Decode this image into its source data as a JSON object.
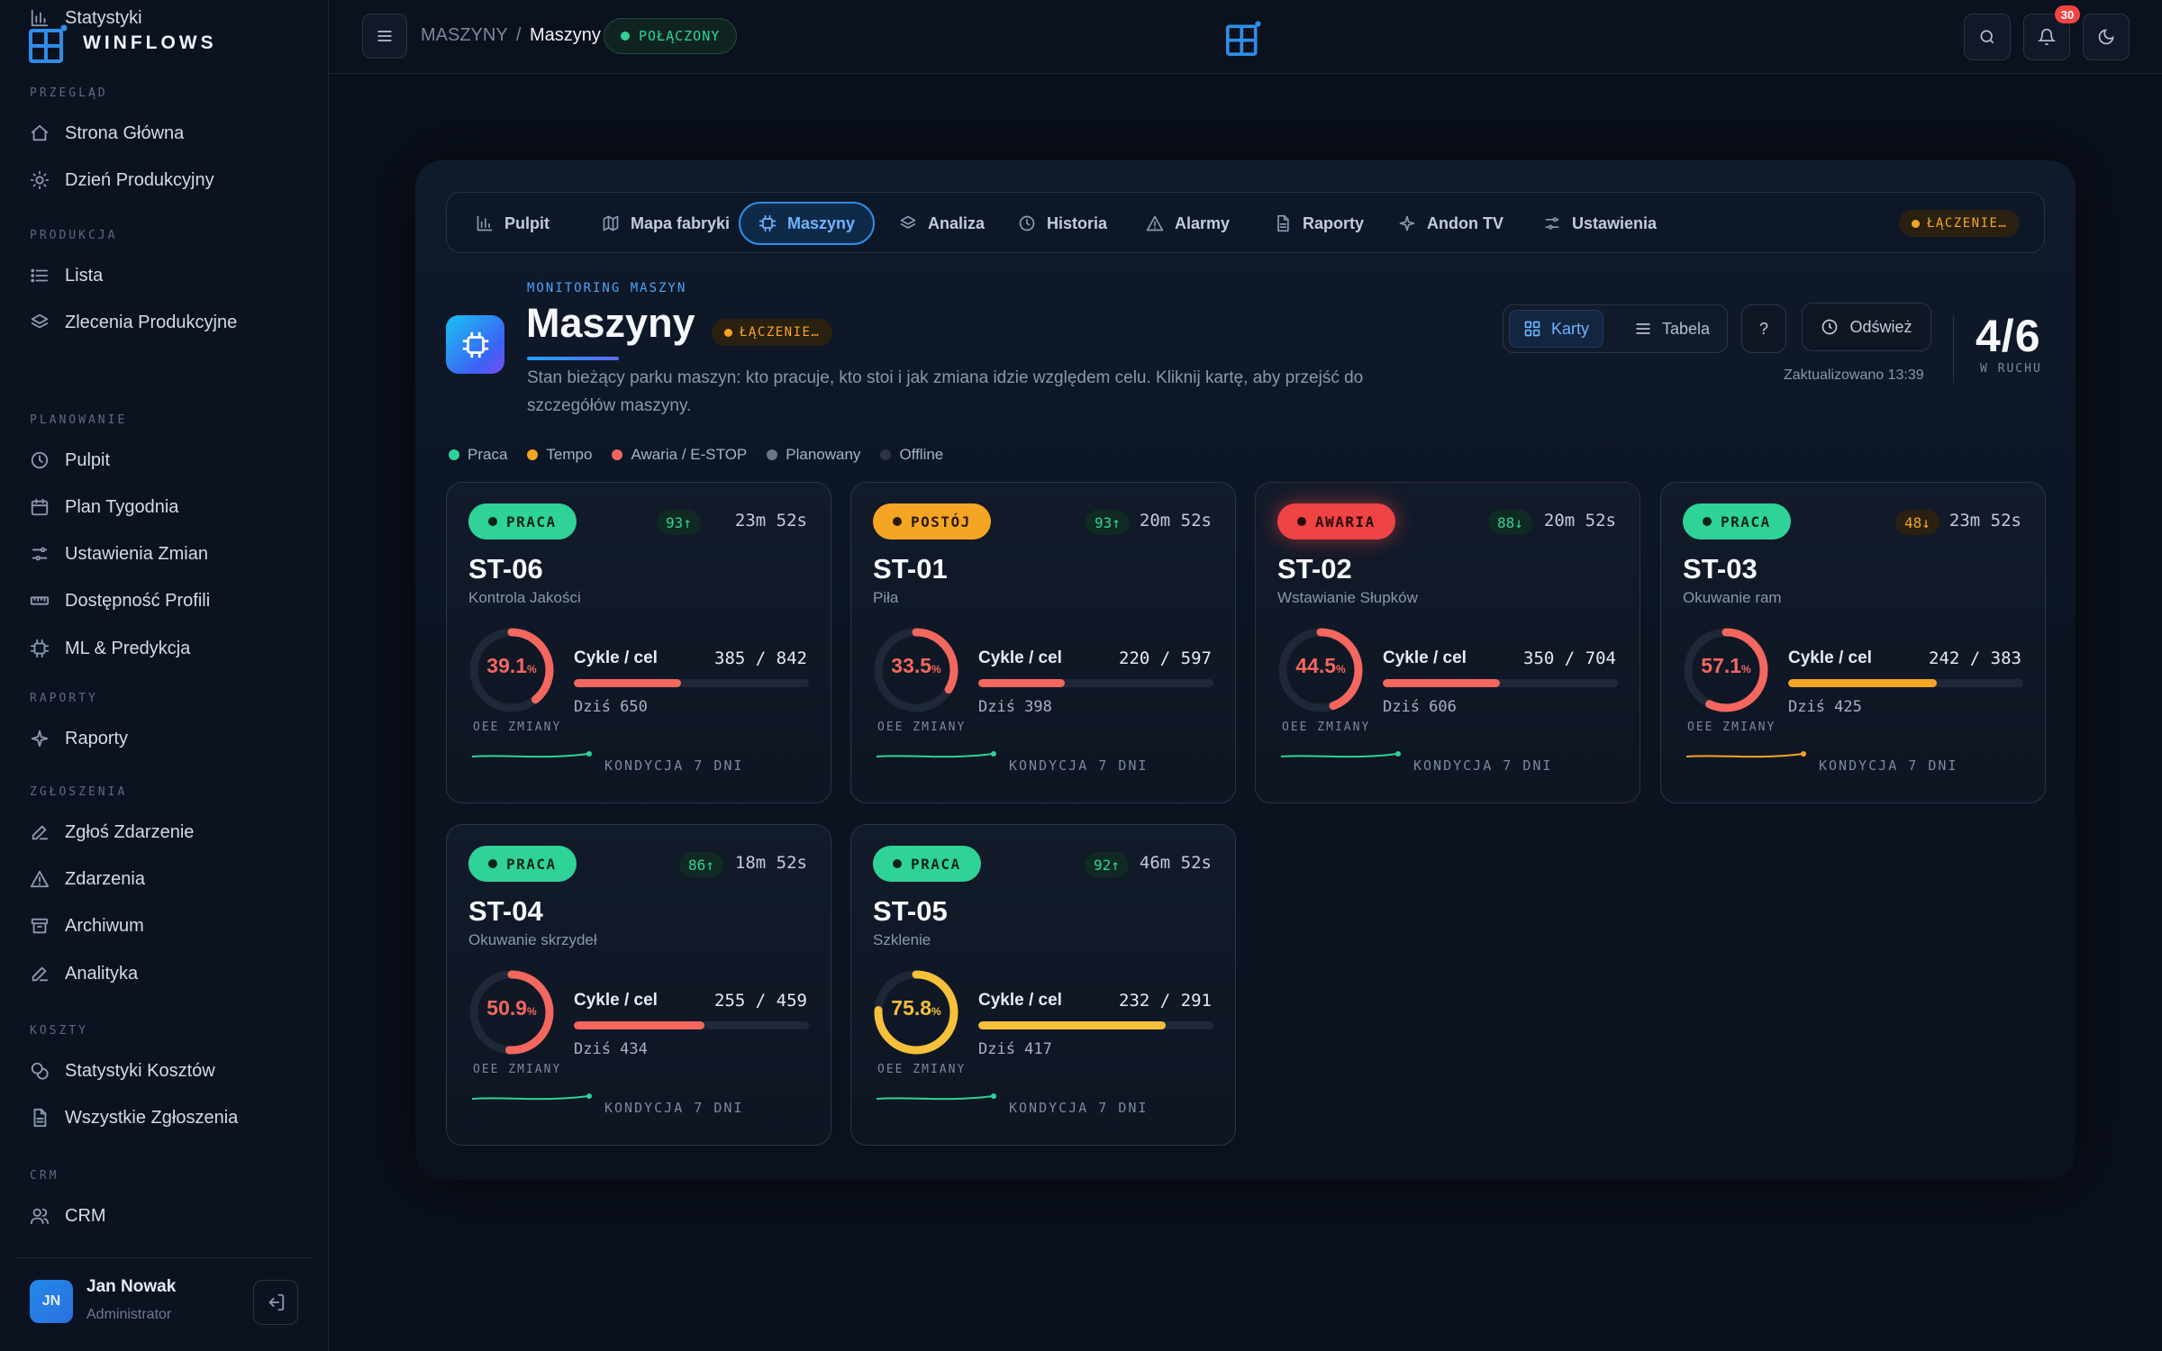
{
  "app": {
    "name": "WINFLOWS"
  },
  "sidebar": {
    "sections": [
      {
        "title": "PRZEGLĄD",
        "items": [
          {
            "label": "Strona Główna",
            "icon": "home-icon"
          },
          {
            "label": "Dzień Produkcyjny",
            "icon": "sun-icon"
          }
        ]
      },
      {
        "title": "PRODUKCJA",
        "items": [
          {
            "label": "Lista",
            "icon": "list-icon"
          },
          {
            "label": "Zlecenia Produkcyjne",
            "icon": "layers-icon"
          },
          {
            "label": "Statystyki",
            "icon": "bar-chart-icon"
          }
        ]
      },
      {
        "title": "PLANOWANIE",
        "items": [
          {
            "label": "Pulpit",
            "icon": "clock-icon"
          },
          {
            "label": "Plan Tygodnia",
            "icon": "calendar-icon"
          },
          {
            "label": "Ustawienia Zmian",
            "icon": "sliders-icon"
          },
          {
            "label": "Dostępność Profili",
            "icon": "ruler-icon"
          },
          {
            "label": "ML & Predykcja",
            "icon": "cpu-icon"
          }
        ]
      },
      {
        "title": "RAPORTY",
        "items": [
          {
            "label": "Raporty",
            "icon": "sparkle-icon"
          }
        ]
      },
      {
        "title": "ZGŁOSZENIA",
        "items": [
          {
            "label": "Zgłoś Zdarzenie",
            "icon": "edit-icon"
          },
          {
            "label": "Zdarzenia",
            "icon": "warning-icon"
          },
          {
            "label": "Archiwum",
            "icon": "archive-icon"
          },
          {
            "label": "Analityka",
            "icon": "edit-icon"
          }
        ]
      },
      {
        "title": "KOSZTY",
        "items": [
          {
            "label": "Statystyki Kosztów",
            "icon": "coins-icon"
          },
          {
            "label": "Wszystkie Zgłoszenia",
            "icon": "document-icon"
          }
        ]
      },
      {
        "title": "CRM",
        "items": [
          {
            "label": "CRM",
            "icon": "users-icon"
          }
        ]
      }
    ],
    "user": {
      "initials": "JN",
      "name": "Jan Nowak",
      "role": "Administrator"
    }
  },
  "topbar": {
    "breadcrumb_parent": "MASZYNY",
    "breadcrumb_sep": "/",
    "breadcrumb_current": "Maszyny",
    "connection_status": "POŁĄCZONY",
    "notifications_count": "30"
  },
  "tabs": [
    {
      "label": "Pulpit",
      "icon": "bar-chart-icon",
      "active": false
    },
    {
      "label": "Mapa fabryki",
      "icon": "map-icon",
      "active": false
    },
    {
      "label": "Maszyny",
      "icon": "cpu-icon",
      "active": true
    },
    {
      "label": "Analiza",
      "icon": "layers-icon",
      "active": false
    },
    {
      "label": "Historia",
      "icon": "clock-icon",
      "active": false
    },
    {
      "label": "Alarmy",
      "icon": "warning-icon",
      "active": false
    },
    {
      "label": "Raporty",
      "icon": "document-icon",
      "active": false
    },
    {
      "label": "Andon TV",
      "icon": "sparkle-icon",
      "active": false
    },
    {
      "label": "Ustawienia",
      "icon": "sliders-icon",
      "active": false
    }
  ],
  "tabs_status": "ŁĄCZENIE…",
  "header": {
    "eyebrow": "MONITORING MASZYN",
    "title": "Maszyny",
    "status": "ŁĄCZENIE…",
    "description": "Stan bieżący parku maszyn: kto pracuje, kto stoi i jak zmiana idzie względem celu. Kliknij kartę, aby przejść do szczegółów maszyny.",
    "view_cards": "Karty",
    "view_table": "Tabela",
    "help": "?",
    "refresh": "Odśwież",
    "updated": "Zaktualizowano 13:39",
    "running": "4/6",
    "running_label": "W RUCHU"
  },
  "legend": [
    {
      "label": "Praca",
      "color": "#2fd397"
    },
    {
      "label": "Tempo",
      "color": "#f5a524"
    },
    {
      "label": "Awaria / E-STOP",
      "color": "#f3675e"
    },
    {
      "label": "Planowany",
      "color": "#6b7587"
    },
    {
      "label": "Offline",
      "color": "#2c3442"
    }
  ],
  "labels": {
    "cycles": "Cykle / cel",
    "oee": "OEE ZMIANY",
    "condition": "KONDYCJA 7 DNI",
    "today_prefix": "Dziś"
  },
  "machines": [
    {
      "id": "ST-06",
      "operation": "Kontrola Jakości",
      "status": "PRACA",
      "status_type": "work",
      "health": "93",
      "health_arrow": "↑",
      "duration": "23m 52s",
      "oee": "39.1",
      "oee_pct": 39.1,
      "oee_color": "#f3675e",
      "cycles": "385 / 842",
      "progress": 0.457,
      "bar_color": "#f3675e",
      "today": "Dziś 650",
      "spark_color": "#2fd397"
    },
    {
      "id": "ST-01",
      "operation": "Piła",
      "status": "POSTÓJ",
      "status_type": "stop",
      "health": "93",
      "health_arrow": "↑",
      "duration": "20m 52s",
      "oee": "33.5",
      "oee_pct": 33.5,
      "oee_color": "#f3675e",
      "cycles": "220 / 597",
      "progress": 0.369,
      "bar_color": "#f3675e",
      "today": "Dziś 398",
      "spark_color": "#2fd397"
    },
    {
      "id": "ST-02",
      "operation": "Wstawianie Słupków",
      "status": "AWARIA",
      "status_type": "alarm",
      "health": "88",
      "health_arrow": "↓",
      "duration": "20m 52s",
      "oee": "44.5",
      "oee_pct": 44.5,
      "oee_color": "#f3675e",
      "cycles": "350 / 704",
      "progress": 0.497,
      "bar_color": "#f3675e",
      "today": "Dziś 606",
      "spark_color": "#2fd397"
    },
    {
      "id": "ST-03",
      "operation": "Okuwanie ram",
      "status": "PRACA",
      "status_type": "work",
      "health": "48",
      "health_arrow": "↓",
      "health_warn": true,
      "duration": "23m 52s",
      "oee": "57.1",
      "oee_pct": 57.1,
      "oee_color": "#f3675e",
      "cycles": "242 / 383",
      "progress": 0.632,
      "bar_color": "#f5a524",
      "today": "Dziś 425",
      "spark_color": "#f5a524"
    },
    {
      "id": "ST-04",
      "operation": "Okuwanie skrzydeł",
      "status": "PRACA",
      "status_type": "work",
      "health": "86",
      "health_arrow": "↑",
      "duration": "18m 52s",
      "oee": "50.9",
      "oee_pct": 50.9,
      "oee_color": "#f3675e",
      "cycles": "255 / 459",
      "progress": 0.556,
      "bar_color": "#f3675e",
      "today": "Dziś 434",
      "spark_color": "#2fd397"
    },
    {
      "id": "ST-05",
      "operation": "Szklenie",
      "status": "PRACA",
      "status_type": "work",
      "health": "92",
      "health_arrow": "↑",
      "duration": "46m 52s",
      "oee": "75.8",
      "oee_pct": 75.8,
      "oee_color": "#f5c03a",
      "cycles": "232 / 291",
      "progress": 0.797,
      "bar_color": "#f5c03a",
      "today": "Dziś 417",
      "spark_color": "#2fd397"
    }
  ]
}
